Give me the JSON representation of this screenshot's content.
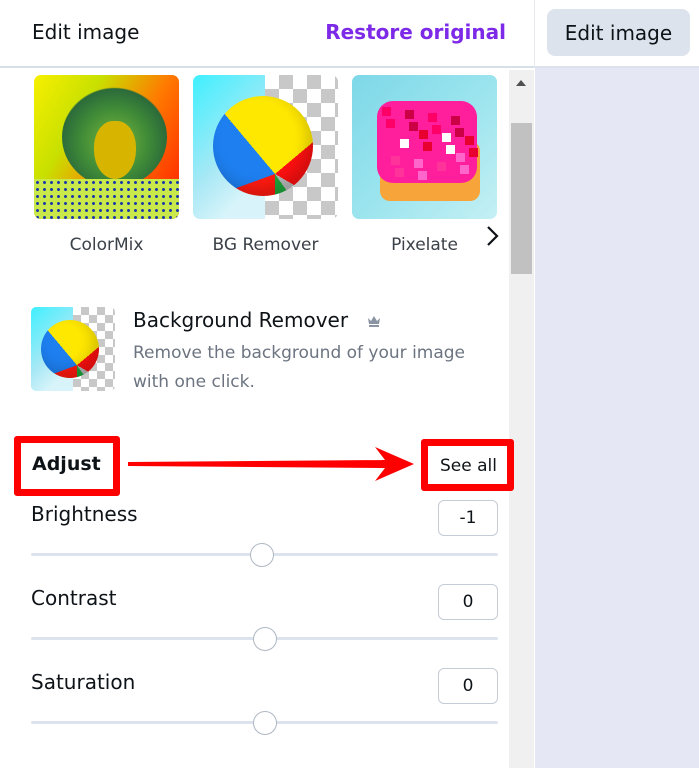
{
  "header": {
    "title": "Edit image",
    "restore_label": "Restore original"
  },
  "right_panel": {
    "edit_image_label": "Edit image"
  },
  "effects": [
    {
      "label": "ColorMix",
      "icon": "colormix-thumbnail"
    },
    {
      "label": "BG Remover",
      "icon": "beach-ball-thumbnail"
    },
    {
      "label": "Pixelate",
      "icon": "pixelated-donut-thumbnail"
    }
  ],
  "feature_card": {
    "title": "Background Remover",
    "badge_icon": "crown-icon",
    "description": "Remove the background of your image with one click."
  },
  "adjust": {
    "title": "Adjust",
    "see_all_label": "See all",
    "sliders": [
      {
        "label": "Brightness",
        "value": "-1",
        "min": -100,
        "max": 100,
        "current": -1
      },
      {
        "label": "Contrast",
        "value": "0",
        "min": -100,
        "max": 100,
        "current": 0
      },
      {
        "label": "Saturation",
        "value": "0",
        "min": -100,
        "max": 100,
        "current": 0
      }
    ]
  },
  "colors": {
    "accent": "#7d2ae8",
    "annotation": "#ff0000",
    "right_panel_bg": "#e5e7f4"
  }
}
